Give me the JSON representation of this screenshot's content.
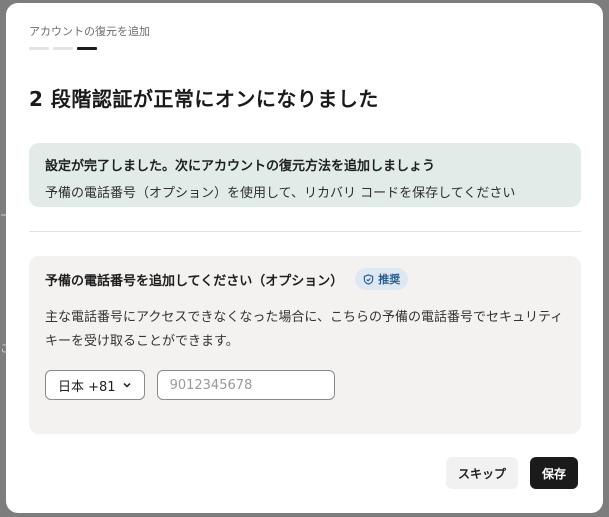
{
  "modal": {
    "step_label": "アカウントの復元を追加",
    "progress": {
      "total_steps": 3,
      "current_step": 3
    },
    "title": "2 段階認証が正常にオンになりました"
  },
  "success_banner": {
    "heading": "設定が完了しました。次にアカウントの復元方法を追加しましょう",
    "subtext": "予備の電話番号（オプション）を使用して、リカバリ コードを保存してください"
  },
  "phone_section": {
    "title": "予備の電話番号を追加してください（オプション）",
    "badge": {
      "label": "推奨",
      "icon": "shield-check-icon",
      "color": "#2f5f8f",
      "background": "#dde8f3"
    },
    "description": "主な電話番号にアクセスできなくなった場合に、こちらの予備の電話番号でセキュリティ キーを受け取ることができます。",
    "country_select": {
      "value": "日本 +81",
      "icon": "chevron-down-icon"
    },
    "phone_input": {
      "placeholder": "9012345678",
      "value": ""
    }
  },
  "actions": {
    "skip_label": "スキップ",
    "save_label": "保存"
  },
  "colors": {
    "overlay": "#7d7d7d",
    "success_background": "#e1ebe7",
    "card_background": "#f4f2f0",
    "primary_button": "#1a1a1a"
  }
}
